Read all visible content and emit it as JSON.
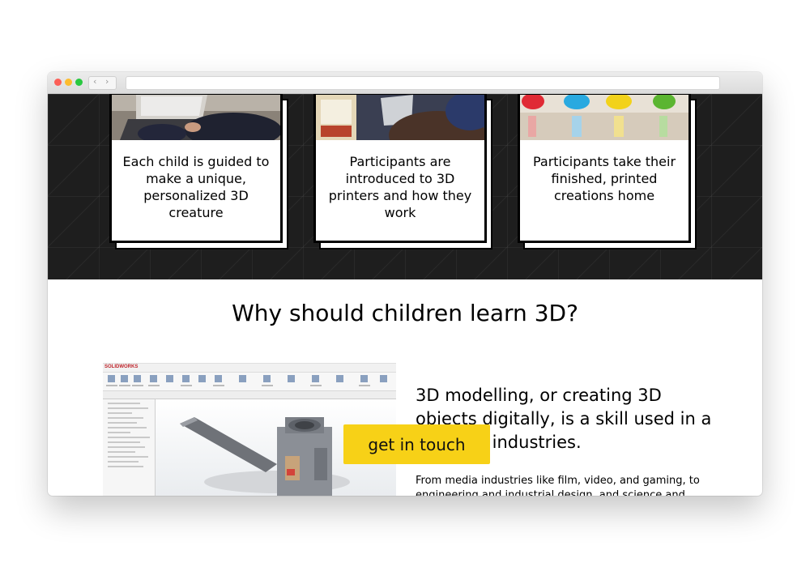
{
  "cards": [
    {
      "caption": "Each child is guided to make a unique, personalized 3D creature"
    },
    {
      "caption": "Participants are introduced to 3D printers and how they work"
    },
    {
      "caption": "Participants take their finished, printed creations home"
    }
  ],
  "section": {
    "title": "Why should children learn 3D?",
    "lead": "3D modelling, or creating 3D objects digitally, is a skill used in a range of industries.",
    "body": "From media industries like film, video, and gaming, to engineering and industrial design, and science and"
  },
  "software": {
    "brand": "SOLIDWORKS"
  },
  "cta": {
    "label": "get in touch"
  },
  "icons": {
    "back": "chevron-left-icon",
    "forward": "chevron-right-icon"
  },
  "colors": {
    "cta": "#f7d117",
    "dark_band": "#1e1e1e"
  }
}
